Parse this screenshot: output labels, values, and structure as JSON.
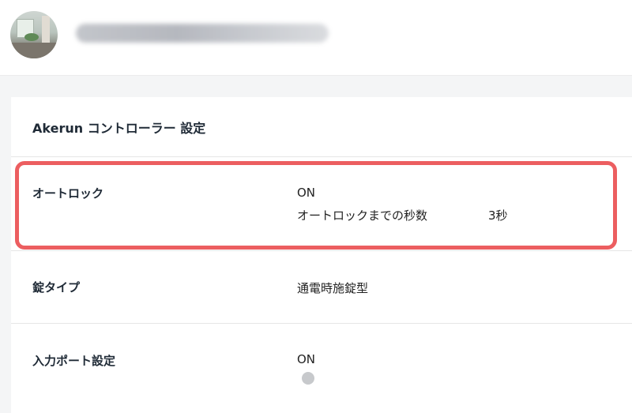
{
  "header": {
    "avatar_icon": "office-photo-icon"
  },
  "panel": {
    "title": "Akerun コントローラー 設定",
    "rows": [
      {
        "label": "オートロック",
        "status": "ON",
        "detail_label": "オートロックまでの秒数",
        "detail_value": "3秒"
      },
      {
        "label": "錠タイプ",
        "value": "通電時施錠型"
      },
      {
        "label": "入力ポート設定",
        "status": "ON",
        "detail_label": "",
        "detail_icon": "info-icon"
      }
    ]
  },
  "colors": {
    "highlight": "#ec5e60",
    "page_bg": "#f4f5f6"
  }
}
